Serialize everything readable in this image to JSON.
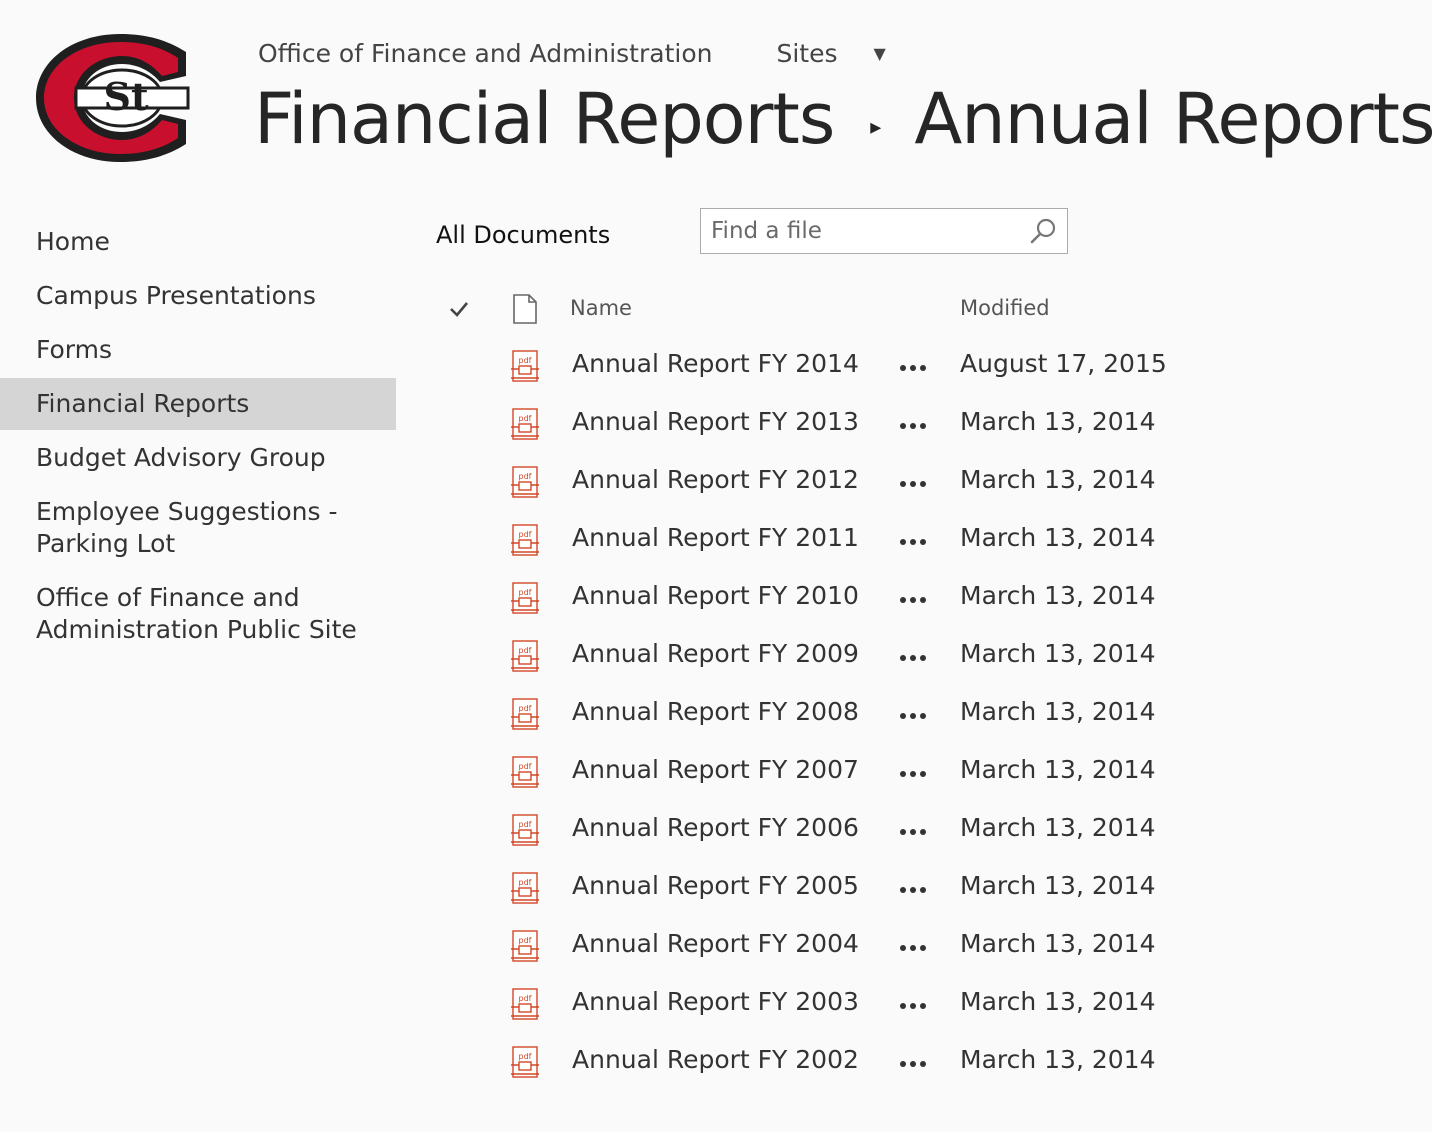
{
  "logo": {
    "text": "St",
    "name": "scsu-c-logo",
    "colors": {
      "red": "#c8102e",
      "black": "#1f1f1f",
      "white": "#ffffff"
    }
  },
  "suite": {
    "site_link": "Office of Finance and Administration",
    "sites_link": "Sites",
    "sites_caret": "▼"
  },
  "title": {
    "parent": "Financial Reports",
    "separator": "▸",
    "current": "Annual Reports"
  },
  "quicklaunch": [
    {
      "label": "Home",
      "selected": false
    },
    {
      "label": "Campus Presentations",
      "selected": false
    },
    {
      "label": "Forms",
      "selected": false
    },
    {
      "label": "Financial Reports",
      "selected": true
    },
    {
      "label": "Budget Advisory Group",
      "selected": false
    },
    {
      "label": "Employee Suggestions - Parking Lot",
      "selected": false
    },
    {
      "label": "Office of Finance and Administration Public Site",
      "selected": false
    }
  ],
  "view": {
    "label": "All Documents"
  },
  "search": {
    "placeholder": "Find a file",
    "value": "",
    "icon": "search-icon"
  },
  "list": {
    "headers": {
      "name": "Name",
      "modified": "Modified"
    },
    "icons": {
      "select_all": "check-icon",
      "type": "document-icon",
      "file": "pdf-icon",
      "menu": "ellipsis-icon"
    },
    "pdf_color": "#d24726",
    "rows": [
      {
        "name": "Annual Report FY 2014",
        "modified": "August 17, 2015"
      },
      {
        "name": "Annual Report FY 2013",
        "modified": "March 13, 2014"
      },
      {
        "name": "Annual Report FY 2012",
        "modified": "March 13, 2014"
      },
      {
        "name": "Annual Report FY 2011",
        "modified": "March 13, 2014"
      },
      {
        "name": "Annual Report FY 2010",
        "modified": "March 13, 2014"
      },
      {
        "name": "Annual Report FY 2009",
        "modified": "March 13, 2014"
      },
      {
        "name": "Annual Report FY 2008",
        "modified": "March 13, 2014"
      },
      {
        "name": "Annual Report FY 2007",
        "modified": "March 13, 2014"
      },
      {
        "name": "Annual Report FY 2006",
        "modified": "March 13, 2014"
      },
      {
        "name": "Annual Report FY 2005",
        "modified": "March 13, 2014"
      },
      {
        "name": "Annual Report FY 2004",
        "modified": "March 13, 2014"
      },
      {
        "name": "Annual Report FY 2003",
        "modified": "March 13, 2014"
      },
      {
        "name": "Annual Report FY 2002",
        "modified": "March 13, 2014"
      }
    ]
  }
}
